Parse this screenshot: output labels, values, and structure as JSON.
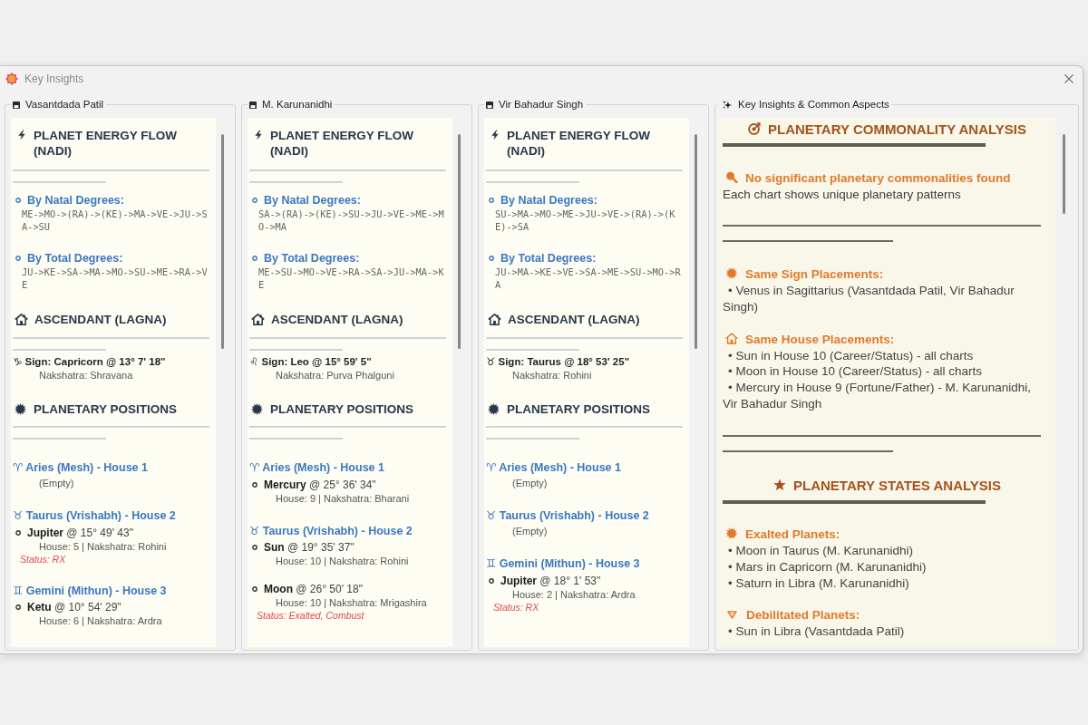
{
  "window": {
    "title": "Key Insights"
  },
  "charts": [
    {
      "name": "Vasantdada Patil",
      "energy_flow": {
        "heading": "PLANET ENERGY FLOW (NADI)",
        "orders": [
          {
            "label": "By Natal Degrees:",
            "sequence": "ME->MO->(RA)->(KE)->MA->VE->JU->SA->SU"
          },
          {
            "label": "By Total Degrees:",
            "sequence": "JU->KE->SA->MA->MO->SU->ME->RA->VE"
          }
        ]
      },
      "ascendant": {
        "heading": "ASCENDANT (LAGNA)",
        "sign": "♑ Sign: Capricorn @ 13° 7' 18\"",
        "nakshatra": "Nakshatra: Shravana"
      },
      "positions": {
        "heading": "PLANETARY POSITIONS",
        "houses": [
          {
            "heading": "♈ Aries (Mesh) - House 1",
            "note": "(Empty)"
          },
          {
            "heading": "♉ Taurus (Vrishabh) - House 2",
            "planets": [
              {
                "position": "**Jupiter** @ 15° 49' 43\"",
                "details": "House: 5 | Nakshatra: Rohini",
                "status": "Status: RX"
              }
            ]
          },
          {
            "heading": "♊ Gemini (Mithun) - House 3",
            "planets": [
              {
                "position": "**Ketu** @ 10° 54' 29\"",
                "details": "House: 6 | Nakshatra: Ardra"
              }
            ]
          }
        ]
      }
    },
    {
      "name": "M. Karunanidhi",
      "energy_flow": {
        "heading": "PLANET ENERGY FLOW (NADI)",
        "orders": [
          {
            "label": "By Natal Degrees:",
            "sequence": "SA->(RA)->(KE)->SU->JU->VE->ME->MO->MA"
          },
          {
            "label": "By Total Degrees:",
            "sequence": "ME->SU->MO->VE->RA->SA->JU->MA->KE"
          }
        ]
      },
      "ascendant": {
        "heading": "ASCENDANT (LAGNA)",
        "sign": "♌ Sign: Leo @ 15° 59' 5\"",
        "nakshatra": "Nakshatra: Purva Phalguni"
      },
      "positions": {
        "heading": "PLANETARY POSITIONS",
        "houses": [
          {
            "heading": "♈ Aries (Mesh) - House 1",
            "planets": [
              {
                "position": "**Mercury** @ 25° 36' 34\"",
                "details": "House: 9 | Nakshatra: Bharani"
              }
            ]
          },
          {
            "heading": "♉ Taurus (Vrishabh) - House 2",
            "planets": [
              {
                "position": "**Sun** @ 19° 35' 37\"",
                "details": "House: 10 | Nakshatra: Rohini"
              },
              {
                "position": "**Moon** @ 26° 50' 18\"",
                "details": "House: 10 | Nakshatra: Mrigashira",
                "status": "Status: Exalted, Combust"
              }
            ]
          }
        ]
      }
    },
    {
      "name": "Vir Bahadur Singh",
      "energy_flow": {
        "heading": "PLANET ENERGY FLOW (NADI)",
        "orders": [
          {
            "label": "By Natal Degrees:",
            "sequence": "SU->MA->MO->ME->JU->VE->(RA)->(KE)->SA"
          },
          {
            "label": "By Total Degrees:",
            "sequence": "JU->MA->KE->VE->SA->ME->SU->MO->RA"
          }
        ]
      },
      "ascendant": {
        "heading": "ASCENDANT (LAGNA)",
        "sign": "♉ Sign: Taurus @ 18° 53' 25\"",
        "nakshatra": "Nakshatra: Rohini"
      },
      "positions": {
        "heading": "PLANETARY POSITIONS",
        "houses": [
          {
            "heading": "♈ Aries (Mesh) - House 1",
            "note": "(Empty)"
          },
          {
            "heading": "♉ Taurus (Vrishabh) - House 2",
            "note": "(Empty)"
          },
          {
            "heading": "♊ Gemini (Mithun) - House 3",
            "planets": [
              {
                "position": "**Jupiter** @ 18° 1' 53\"",
                "details": "House: 2 | Nakshatra: Ardra",
                "status": "Status: RX"
              }
            ]
          }
        ]
      }
    }
  ],
  "insights": {
    "title": "Key Insights & Common Aspects",
    "commonality": {
      "heading": "PLANETARY COMMONALITY ANALYSIS",
      "summary": {
        "heading": "No significant planetary commonalities found",
        "text": "Each chart shows unique planetary patterns"
      },
      "same_sign": {
        "heading": "Same Sign Placements:",
        "items": [
          "• Venus in Sagittarius (Vasantdada Patil, Vir Bahadur Singh)"
        ]
      },
      "same_house": {
        "heading": "Same House Placements:",
        "items": [
          "• Sun in House 10 (Career/Status) - all charts",
          "• Moon in House 10 (Career/Status) - all charts",
          "• Mercury in House 9 (Fortune/Father) - M. Karunanidhi, Vir Bahadur Singh"
        ]
      }
    },
    "states": {
      "heading": "PLANETARY STATES ANALYSIS",
      "exalted": {
        "heading": "Exalted Planets:",
        "items": [
          "• Moon in Taurus (M. Karunanidhi)",
          "• Mars in Capricorn (M. Karunanidhi)",
          "• Saturn in Libra (M. Karunanidhi)"
        ]
      },
      "debilitated": {
        "heading": "Debilitated Planets:",
        "items": [
          "• Sun in Libra (Vasantdada Patil)"
        ]
      }
    }
  }
}
